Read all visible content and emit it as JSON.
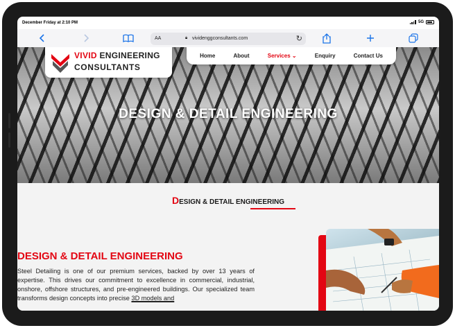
{
  "status_bar": {
    "time": "December Friday at 2:10 PM",
    "network": "5G"
  },
  "browser": {
    "reader_label": "AA",
    "url": "vividenggconsultants.com"
  },
  "logo": {
    "name_red": "VIVID",
    "name_rest": " ENGINEERING",
    "line2": "CONSULTANTS"
  },
  "nav": {
    "items": [
      "Home",
      "About",
      "Services",
      "Enquiry",
      "Contact Us"
    ],
    "services_caret": "⌄"
  },
  "hero": {
    "title": "DESIGN & DETAIL ENGINEERING"
  },
  "section": {
    "heading_initial": "D",
    "heading_rest": "ESIGN & DETAIL ENGINEERING"
  },
  "content": {
    "title": "DESIGN & DETAIL ENGINEERING",
    "body": "Steel Detailing is one of our premium services, backed by over 13 years of expertise. This drives our commitment to excellence in commercial, industrial, onshore, offshore structures, and pre-engineered buildings. Our specialized team transforms design concepts into precise",
    "body_link": "3D models and"
  },
  "colors": {
    "accent": "#e30613",
    "browser_blue": "#1a73e8",
    "dark": "#222222"
  },
  "icons": [
    "back-icon",
    "forward-icon",
    "bookmarks-icon",
    "lock-icon",
    "reload-icon",
    "share-icon",
    "new-tab-icon",
    "tabs-icon",
    "battery-icon",
    "signal-icon"
  ]
}
